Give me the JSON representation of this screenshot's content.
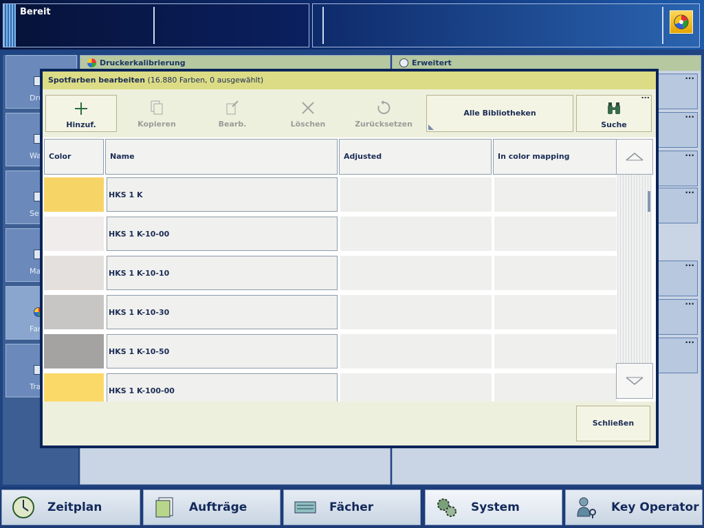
{
  "status": {
    "text": "Bereit",
    "color_button_icon": "color-wheel-icon"
  },
  "background": {
    "nav_items": [
      {
        "label": "Dru",
        "icon": "print-icon"
      },
      {
        "label": "War",
        "icon": "queue-icon"
      },
      {
        "label": "Se",
        "icon": "settings-icon"
      },
      {
        "label": "Mat",
        "icon": "media-icon"
      },
      {
        "label": "Farbju",
        "icon": "color-wheel-icon",
        "active": true
      },
      {
        "label": "Trans",
        "icon": "transfer-icon"
      }
    ],
    "panel_left_title": "Druckerkalibrierung",
    "panel_right_title": "Erweitert"
  },
  "dialog": {
    "title": "Spotfarben bearbeiten",
    "subtitle": "(16.880 Farben, 0 ausgewählt)",
    "toolbar": {
      "add": "Hinzuf.",
      "copy": "Kopieren",
      "edit": "Bearb.",
      "delete": "Löschen",
      "reset": "Zurücksetzen",
      "libraries": "Alle Bibliotheken",
      "search": "Suche",
      "more": "..."
    },
    "columns": {
      "color": "Color",
      "name": "Name",
      "adjusted": "Adjusted",
      "mapping": "In color mapping"
    },
    "rows": [
      {
        "name": "HKS 1 K",
        "color": "#f7d466"
      },
      {
        "name": "HKS 1 K-10-00",
        "color": "#f0eceb"
      },
      {
        "name": "HKS 1 K-10-10",
        "color": "#e4e0de"
      },
      {
        "name": "HKS 1 K-10-30",
        "color": "#c8c6c4"
      },
      {
        "name": "HKS 1 K-10-50",
        "color": "#a4a3a2"
      },
      {
        "name": "HKS 1 K-100-00",
        "color": "#fbd968"
      }
    ],
    "close": "Schließen"
  },
  "tabs": [
    {
      "label": "Zeitplan",
      "icon": "clock-icon"
    },
    {
      "label": "Aufträge",
      "icon": "jobs-icon"
    },
    {
      "label": "Fächer",
      "icon": "trays-icon"
    },
    {
      "label": "System",
      "icon": "gears-icon",
      "selected": true
    },
    {
      "label": "Key Operator",
      "icon": "key-operator-icon"
    }
  ]
}
